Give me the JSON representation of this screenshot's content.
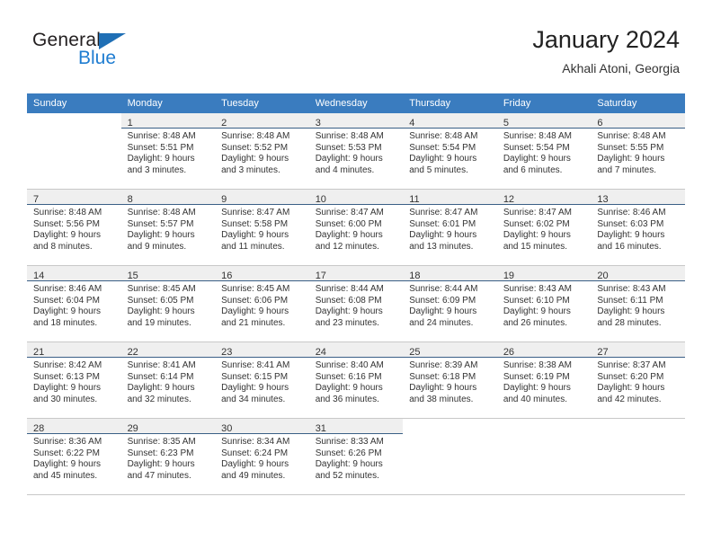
{
  "logo": {
    "word1": "General",
    "word2": "Blue",
    "triangle_color": "#1f6fb5",
    "word2_color": "#1f7dd1"
  },
  "header": {
    "title": "January 2024",
    "subtitle": "Akhali Atoni, Georgia"
  },
  "theme": {
    "header_row_bg": "#3a7cbf",
    "header_row_text": "#ffffff",
    "day_band_bg": "#efefef",
    "day_band_rule": "#3a5f86",
    "row_separator": "#c8c8c8"
  },
  "weekday_headers": [
    "Sunday",
    "Monday",
    "Tuesday",
    "Wednesday",
    "Thursday",
    "Friday",
    "Saturday"
  ],
  "labels": {
    "sunrise_prefix": "Sunrise:",
    "sunset_prefix": "Sunset:",
    "daylight_prefix": "Daylight:"
  },
  "weeks": [
    [
      {
        "day": "",
        "line1": "",
        "line2": "",
        "line3": "",
        "line4": "",
        "empty": true
      },
      {
        "day": "1",
        "line1": "Sunrise: 8:48 AM",
        "line2": "Sunset: 5:51 PM",
        "line3": "Daylight: 9 hours",
        "line4": "and 3 minutes.",
        "empty": false
      },
      {
        "day": "2",
        "line1": "Sunrise: 8:48 AM",
        "line2": "Sunset: 5:52 PM",
        "line3": "Daylight: 9 hours",
        "line4": "and 3 minutes.",
        "empty": false
      },
      {
        "day": "3",
        "line1": "Sunrise: 8:48 AM",
        "line2": "Sunset: 5:53 PM",
        "line3": "Daylight: 9 hours",
        "line4": "and 4 minutes.",
        "empty": false
      },
      {
        "day": "4",
        "line1": "Sunrise: 8:48 AM",
        "line2": "Sunset: 5:54 PM",
        "line3": "Daylight: 9 hours",
        "line4": "and 5 minutes.",
        "empty": false
      },
      {
        "day": "5",
        "line1": "Sunrise: 8:48 AM",
        "line2": "Sunset: 5:54 PM",
        "line3": "Daylight: 9 hours",
        "line4": "and 6 minutes.",
        "empty": false
      },
      {
        "day": "6",
        "line1": "Sunrise: 8:48 AM",
        "line2": "Sunset: 5:55 PM",
        "line3": "Daylight: 9 hours",
        "line4": "and 7 minutes.",
        "empty": false
      }
    ],
    [
      {
        "day": "7",
        "line1": "Sunrise: 8:48 AM",
        "line2": "Sunset: 5:56 PM",
        "line3": "Daylight: 9 hours",
        "line4": "and 8 minutes.",
        "empty": false
      },
      {
        "day": "8",
        "line1": "Sunrise: 8:48 AM",
        "line2": "Sunset: 5:57 PM",
        "line3": "Daylight: 9 hours",
        "line4": "and 9 minutes.",
        "empty": false
      },
      {
        "day": "9",
        "line1": "Sunrise: 8:47 AM",
        "line2": "Sunset: 5:58 PM",
        "line3": "Daylight: 9 hours",
        "line4": "and 11 minutes.",
        "empty": false
      },
      {
        "day": "10",
        "line1": "Sunrise: 8:47 AM",
        "line2": "Sunset: 6:00 PM",
        "line3": "Daylight: 9 hours",
        "line4": "and 12 minutes.",
        "empty": false
      },
      {
        "day": "11",
        "line1": "Sunrise: 8:47 AM",
        "line2": "Sunset: 6:01 PM",
        "line3": "Daylight: 9 hours",
        "line4": "and 13 minutes.",
        "empty": false
      },
      {
        "day": "12",
        "line1": "Sunrise: 8:47 AM",
        "line2": "Sunset: 6:02 PM",
        "line3": "Daylight: 9 hours",
        "line4": "and 15 minutes.",
        "empty": false
      },
      {
        "day": "13",
        "line1": "Sunrise: 8:46 AM",
        "line2": "Sunset: 6:03 PM",
        "line3": "Daylight: 9 hours",
        "line4": "and 16 minutes.",
        "empty": false
      }
    ],
    [
      {
        "day": "14",
        "line1": "Sunrise: 8:46 AM",
        "line2": "Sunset: 6:04 PM",
        "line3": "Daylight: 9 hours",
        "line4": "and 18 minutes.",
        "empty": false
      },
      {
        "day": "15",
        "line1": "Sunrise: 8:45 AM",
        "line2": "Sunset: 6:05 PM",
        "line3": "Daylight: 9 hours",
        "line4": "and 19 minutes.",
        "empty": false
      },
      {
        "day": "16",
        "line1": "Sunrise: 8:45 AM",
        "line2": "Sunset: 6:06 PM",
        "line3": "Daylight: 9 hours",
        "line4": "and 21 minutes.",
        "empty": false
      },
      {
        "day": "17",
        "line1": "Sunrise: 8:44 AM",
        "line2": "Sunset: 6:08 PM",
        "line3": "Daylight: 9 hours",
        "line4": "and 23 minutes.",
        "empty": false
      },
      {
        "day": "18",
        "line1": "Sunrise: 8:44 AM",
        "line2": "Sunset: 6:09 PM",
        "line3": "Daylight: 9 hours",
        "line4": "and 24 minutes.",
        "empty": false
      },
      {
        "day": "19",
        "line1": "Sunrise: 8:43 AM",
        "line2": "Sunset: 6:10 PM",
        "line3": "Daylight: 9 hours",
        "line4": "and 26 minutes.",
        "empty": false
      },
      {
        "day": "20",
        "line1": "Sunrise: 8:43 AM",
        "line2": "Sunset: 6:11 PM",
        "line3": "Daylight: 9 hours",
        "line4": "and 28 minutes.",
        "empty": false
      }
    ],
    [
      {
        "day": "21",
        "line1": "Sunrise: 8:42 AM",
        "line2": "Sunset: 6:13 PM",
        "line3": "Daylight: 9 hours",
        "line4": "and 30 minutes.",
        "empty": false
      },
      {
        "day": "22",
        "line1": "Sunrise: 8:41 AM",
        "line2": "Sunset: 6:14 PM",
        "line3": "Daylight: 9 hours",
        "line4": "and 32 minutes.",
        "empty": false
      },
      {
        "day": "23",
        "line1": "Sunrise: 8:41 AM",
        "line2": "Sunset: 6:15 PM",
        "line3": "Daylight: 9 hours",
        "line4": "and 34 minutes.",
        "empty": false
      },
      {
        "day": "24",
        "line1": "Sunrise: 8:40 AM",
        "line2": "Sunset: 6:16 PM",
        "line3": "Daylight: 9 hours",
        "line4": "and 36 minutes.",
        "empty": false
      },
      {
        "day": "25",
        "line1": "Sunrise: 8:39 AM",
        "line2": "Sunset: 6:18 PM",
        "line3": "Daylight: 9 hours",
        "line4": "and 38 minutes.",
        "empty": false
      },
      {
        "day": "26",
        "line1": "Sunrise: 8:38 AM",
        "line2": "Sunset: 6:19 PM",
        "line3": "Daylight: 9 hours",
        "line4": "and 40 minutes.",
        "empty": false
      },
      {
        "day": "27",
        "line1": "Sunrise: 8:37 AM",
        "line2": "Sunset: 6:20 PM",
        "line3": "Daylight: 9 hours",
        "line4": "and 42 minutes.",
        "empty": false
      }
    ],
    [
      {
        "day": "28",
        "line1": "Sunrise: 8:36 AM",
        "line2": "Sunset: 6:22 PM",
        "line3": "Daylight: 9 hours",
        "line4": "and 45 minutes.",
        "empty": false
      },
      {
        "day": "29",
        "line1": "Sunrise: 8:35 AM",
        "line2": "Sunset: 6:23 PM",
        "line3": "Daylight: 9 hours",
        "line4": "and 47 minutes.",
        "empty": false
      },
      {
        "day": "30",
        "line1": "Sunrise: 8:34 AM",
        "line2": "Sunset: 6:24 PM",
        "line3": "Daylight: 9 hours",
        "line4": "and 49 minutes.",
        "empty": false
      },
      {
        "day": "31",
        "line1": "Sunrise: 8:33 AM",
        "line2": "Sunset: 6:26 PM",
        "line3": "Daylight: 9 hours",
        "line4": "and 52 minutes.",
        "empty": false
      },
      {
        "day": "",
        "line1": "",
        "line2": "",
        "line3": "",
        "line4": "",
        "empty": true
      },
      {
        "day": "",
        "line1": "",
        "line2": "",
        "line3": "",
        "line4": "",
        "empty": true
      },
      {
        "day": "",
        "line1": "",
        "line2": "",
        "line3": "",
        "line4": "",
        "empty": true
      }
    ]
  ]
}
